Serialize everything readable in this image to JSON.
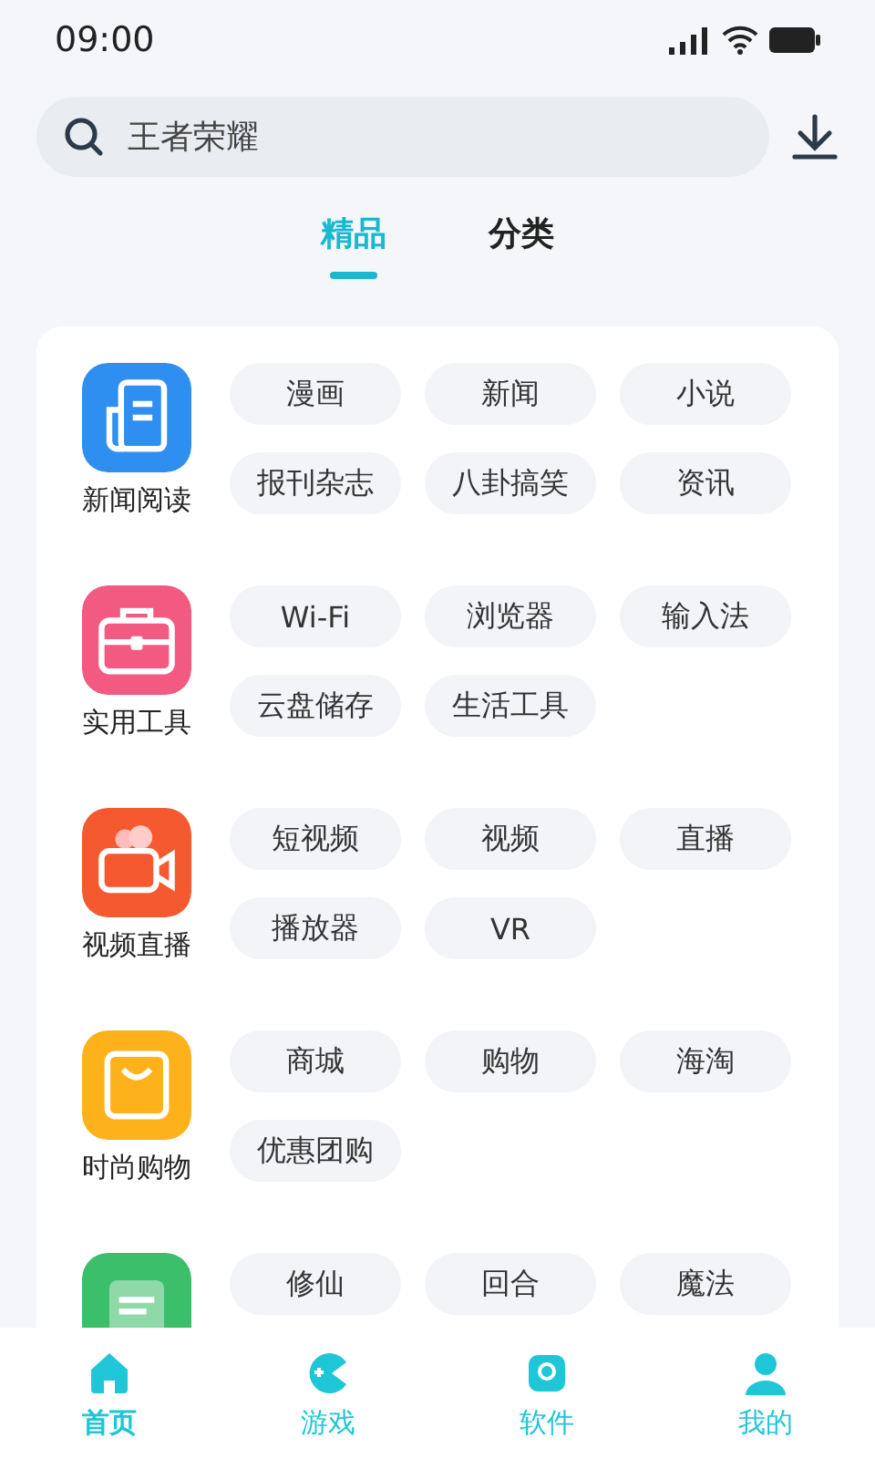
{
  "status_bar": {
    "time": "09:00"
  },
  "search": {
    "placeholder": "王者荣耀"
  },
  "tabs": [
    {
      "label": "精品",
      "selected": true
    },
    {
      "label": "分类",
      "selected": false
    }
  ],
  "categories": [
    {
      "name": "新闻阅读",
      "kind": "news",
      "color": "#2f8ff0",
      "tags": [
        "漫画",
        "新闻",
        "小说",
        "报刊杂志",
        "八卦搞笑",
        "资讯"
      ]
    },
    {
      "name": "实用工具",
      "kind": "toolbox",
      "color": "#f25a82",
      "tags": [
        "Wi-Fi",
        "浏览器",
        "输入法",
        "云盘储存",
        "生活工具"
      ]
    },
    {
      "name": "视频直播",
      "kind": "camera",
      "color": "#f5592f",
      "tags": [
        "短视频",
        "视频",
        "直播",
        "播放器",
        "VR"
      ]
    },
    {
      "name": "时尚购物",
      "kind": "bag",
      "color": "#fdb21c",
      "tags": [
        "商城",
        "购物",
        "海淘",
        "优惠团购"
      ]
    },
    {
      "kind": "game",
      "color": "#3cbf6a",
      "tags": [
        "修仙",
        "回合",
        "魔法"
      ]
    }
  ],
  "bottom_nav": [
    {
      "label": "首页",
      "kind": "home",
      "selected": true
    },
    {
      "label": "游戏",
      "kind": "game",
      "selected": false
    },
    {
      "label": "软件",
      "kind": "app",
      "selected": false
    },
    {
      "label": "我的",
      "kind": "user",
      "selected": false
    }
  ]
}
